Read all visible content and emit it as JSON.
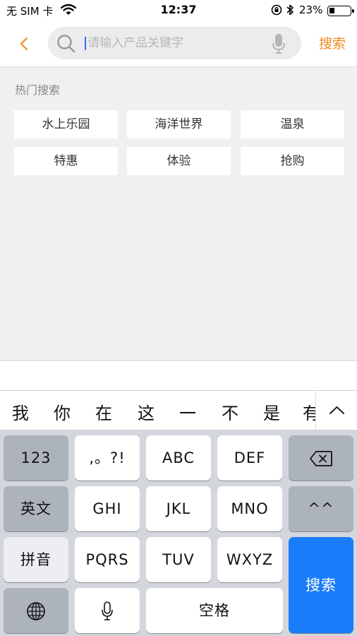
{
  "status_bar": {
    "carrier": "无 SIM 卡",
    "time": "12:37",
    "battery": "23%"
  },
  "nav": {
    "search_placeholder": "请输入产品关键字",
    "search_button": "搜索",
    "accent_color": "#f08a24"
  },
  "hot_search": {
    "title": "热门搜索",
    "tags": [
      "水上乐园",
      "海洋世界",
      "温泉",
      "特惠",
      "体验",
      "抢购"
    ]
  },
  "keyboard": {
    "candidates": [
      "我",
      "你",
      "在",
      "这",
      "一",
      "不",
      "是",
      "有"
    ],
    "keys": {
      "num": "123",
      "punct": ",。?!",
      "abc": "ABC",
      "def": "DEF",
      "english": "英文",
      "ghi": "GHI",
      "jkl": "JKL",
      "mno": "MNO",
      "emoticon": "^^",
      "pinyin": "拼音",
      "pqrs": "PQRS",
      "tuv": "TUV",
      "wxyz": "WXYZ",
      "search": "搜索",
      "space": "空格"
    },
    "return_color": "#1a7cf8"
  }
}
